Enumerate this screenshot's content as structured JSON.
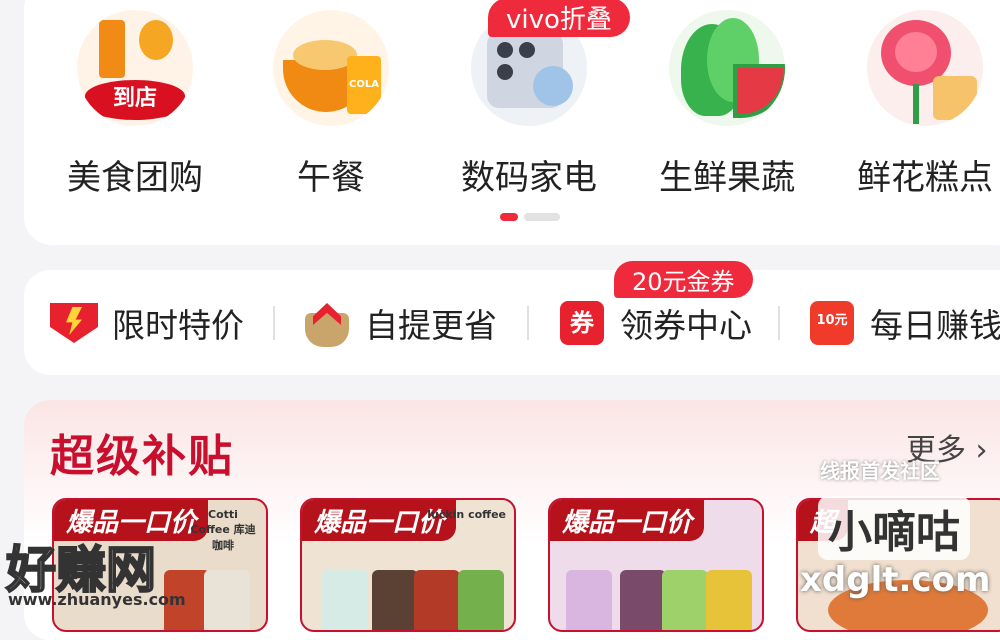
{
  "categories": [
    {
      "label": "美食团购",
      "icon": "food-groupbuy-icon",
      "icon_text": "到店"
    },
    {
      "label": "午餐",
      "icon": "lunch-icon",
      "icon_text": "COLA"
    },
    {
      "label": "数码家电",
      "icon": "digital-appliance-icon",
      "badge": "vivo折叠"
    },
    {
      "label": "生鲜果蔬",
      "icon": "fresh-produce-icon"
    },
    {
      "label": "鲜花糕点",
      "icon": "flower-cake-icon"
    }
  ],
  "quick_actions": [
    {
      "label": "限时特价",
      "icon": "lightning-icon"
    },
    {
      "label": "自提更省",
      "icon": "pickup-icon"
    },
    {
      "label": "领券中心",
      "icon": "coupon-icon",
      "icon_text": "券",
      "badge": "20元金券"
    },
    {
      "label": "每日赚钱",
      "icon": "daily-earn-icon",
      "icon_text": "10元"
    }
  ],
  "subsidy": {
    "title": "超级补贴",
    "more": "更多 ›",
    "products": [
      {
        "tag": "爆品一口价",
        "brand": "Cotti Coffee 库迪咖啡"
      },
      {
        "tag": "爆品一口价",
        "brand": "luckin coffee"
      },
      {
        "tag": "爆品一口价",
        "brand": ""
      },
      {
        "tag": "超",
        "brand": ""
      }
    ]
  },
  "watermarks": {
    "a": "线报首发社区",
    "b": "小嘀咕",
    "c": "xdglt.com",
    "d": "好赚网",
    "e": "www.zhuanyes.com"
  },
  "colors": {
    "accent": "#ee2a3c",
    "brand_red": "#c8102e"
  }
}
